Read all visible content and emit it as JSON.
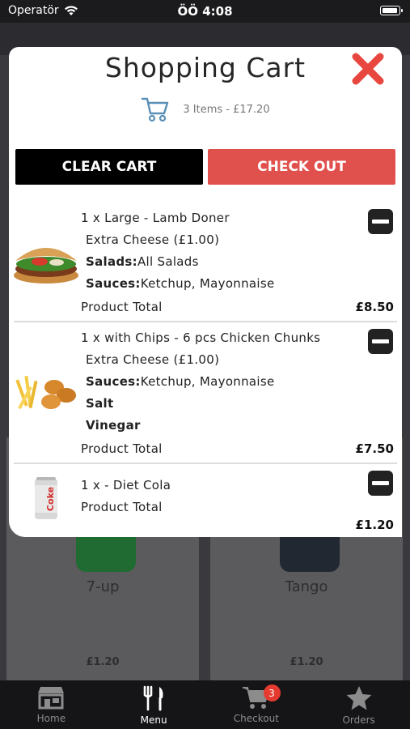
{
  "status_bar": {
    "carrier": "Operatör",
    "time": "ÖÖ 4:08",
    "battery_level": 0.95
  },
  "background_menu": {
    "items": [
      {
        "name": "7-up",
        "price": "£1.20",
        "can_color": "#1f6b32"
      },
      {
        "name": "Tango",
        "price": "£1.20",
        "can_color": "#222831"
      }
    ]
  },
  "cart": {
    "title": "Shopping Cart",
    "summary": "3 Items - £17.20",
    "clear_label": "CLEAR CART",
    "checkout_label": "CHECK OUT",
    "items": [
      {
        "title": "1 x Large - Lamb Doner",
        "extra": "Extra Cheese (£1.00)",
        "salads_label": "Salads:",
        "salads_value": "All Salads",
        "sauces_label": "Sauces:",
        "sauces_value": "Ketchup, Mayonnaise",
        "total_label": "Product Total",
        "price": "£8.50",
        "image": "kebab-wrap-image"
      },
      {
        "title": "1 x with Chips - 6 pcs Chicken Chunks",
        "extra": "Extra Cheese (£1.00)",
        "sauces_label": "Sauces:",
        "sauces_value": "Ketchup, Mayonnaise",
        "option1": "Salt",
        "option2": "Vinegar",
        "total_label": "Product Total",
        "price": "£7.50",
        "image": "chicken-chips-image"
      },
      {
        "title": "1 x - Diet Cola",
        "total_label": "Product Total",
        "price": "£1.20",
        "image": "diet-coke-can-image",
        "can_text": "Coke"
      }
    ]
  },
  "tabbar": {
    "tabs": [
      {
        "label": "Home",
        "icon": "store-icon"
      },
      {
        "label": "Menu",
        "icon": "cutlery-icon"
      },
      {
        "label": "Checkout",
        "icon": "cart-icon",
        "badge": "3"
      },
      {
        "label": "Orders",
        "icon": "star-icon"
      }
    ],
    "active": "Menu"
  },
  "colors": {
    "accent_red": "#e0504d",
    "close_red": "#e8473f",
    "cart_icon_blue": "#5a8fb8"
  }
}
